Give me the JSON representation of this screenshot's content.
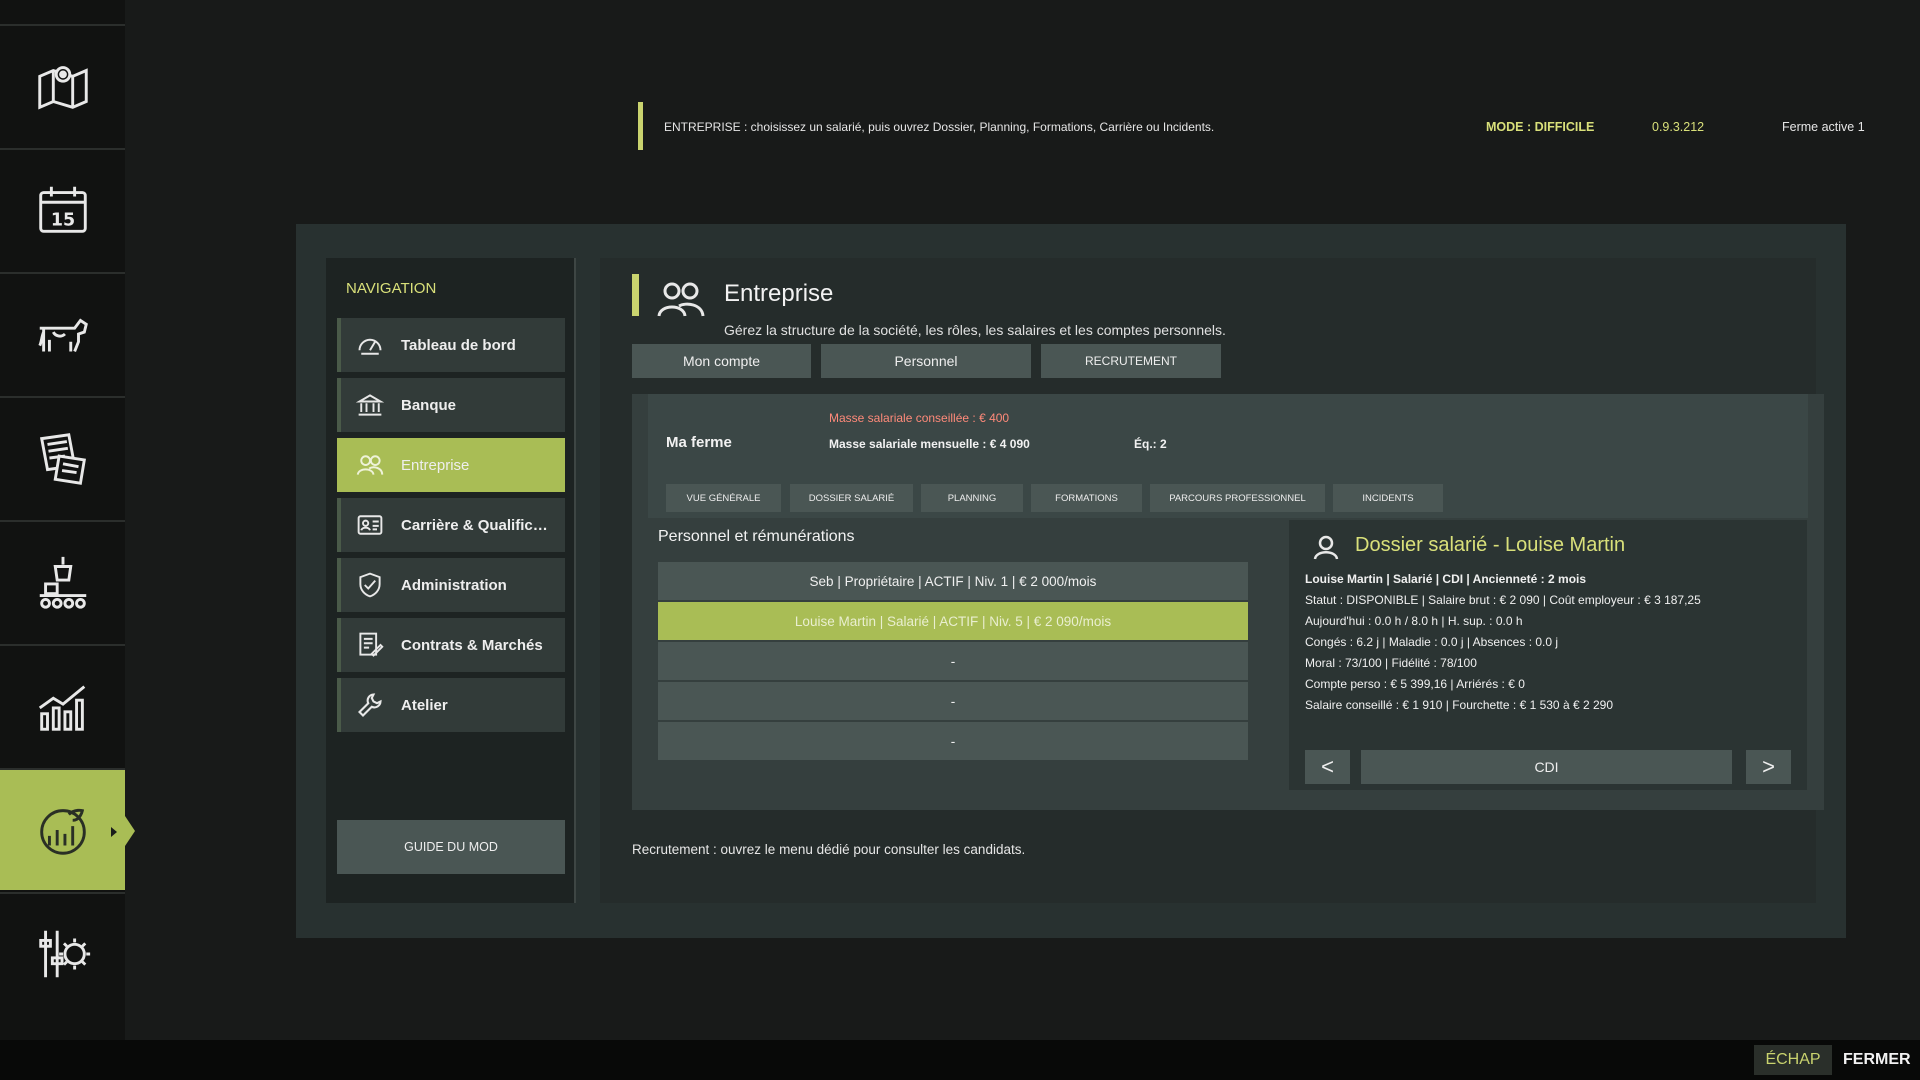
{
  "topbar": {
    "hint": "ENTREPRISE : choisissez un salarié, puis ouvrez Dossier, Planning, Formations, Carrière ou Incidents.",
    "mode": "MODE : DIFFICILE",
    "version": "0.9.3.212",
    "farm": "Ferme active 1"
  },
  "rail": {
    "items": [
      {
        "icon": "map-icon"
      },
      {
        "icon": "calendar-icon",
        "text": "15"
      },
      {
        "icon": "cow-icon"
      },
      {
        "icon": "contracts-icon"
      },
      {
        "icon": "production-icon"
      },
      {
        "icon": "statistics-icon"
      },
      {
        "icon": "farm-manager-icon",
        "active": true
      },
      {
        "icon": "settings-icon"
      }
    ]
  },
  "nav": {
    "title": "NAVIGATION",
    "items": [
      {
        "label": "Tableau de bord",
        "icon": "speedometer-icon"
      },
      {
        "label": "Banque",
        "icon": "bank-icon"
      },
      {
        "label": "Entreprise",
        "icon": "people-icon",
        "active": true
      },
      {
        "label": "Carrière & Qualificat...",
        "icon": "id-card-icon"
      },
      {
        "label": "Administration",
        "icon": "shield-check-icon"
      },
      {
        "label": "Contrats & Marchés",
        "icon": "contract-icon"
      },
      {
        "label": "Atelier",
        "icon": "wrench-icon"
      }
    ],
    "guide": "GUIDE DU MOD"
  },
  "content": {
    "title": "Entreprise",
    "subtitle": "Gérez la structure de la société, les rôles, les salaires et les comptes personnels.",
    "buttons": [
      "Mon compte",
      "Personnel",
      "RECRUTEMENT"
    ],
    "farm": {
      "name": "Ma ferme",
      "advised": "Masse salariale conseillée : € 400",
      "monthly": "Masse salariale mensuelle : € 4 090",
      "eq": "Éq.: 2"
    },
    "subtabs": [
      "VUE GÉNÉRALE",
      "DOSSIER SALARIÉ",
      "PLANNING",
      "FORMATIONS",
      "PARCOURS PROFESSIONNEL",
      "INCIDENTS"
    ],
    "list_title": "Personnel et rémunérations",
    "rows": [
      "Seb | Propriétaire | ACTIF | Niv. 1 | € 2 000/mois",
      "Louise Martin | Salarié | ACTIF | Niv. 5 | € 2 090/mois",
      "-",
      "-",
      "-"
    ],
    "dossier": {
      "title": "Dossier salarié - Louise Martin",
      "lines": [
        "Louise Martin | Salarié | CDI | Ancienneté : 2 mois",
        "Statut : DISPONIBLE | Salaire brut : € 2 090 | Coût employeur : € 3 187,25",
        "Aujourd'hui : 0.0 h / 8.0 h | H. sup. : 0.0 h",
        "Congés : 6.2 j | Maladie : 0.0 j | Absences : 0.0 j",
        "Moral : 73/100 | Fidélité : 78/100",
        "Compte perso : € 5 399,16 | Arriérés : € 0",
        "Salaire conseillé : € 1 910 | Fourchette : € 1 530 à € 2 290"
      ],
      "prev": "<",
      "contract": "CDI",
      "next": ">"
    },
    "recruit_note": "Recrutement : ouvrez le menu dédié pour consulter les candidats."
  },
  "bottom": {
    "esc": "ÉCHAP",
    "close": "FERMER"
  },
  "colors": {
    "accent": "#a9bd55",
    "highlight_text": "#d9e07a",
    "warning": "#ff8a7a"
  }
}
